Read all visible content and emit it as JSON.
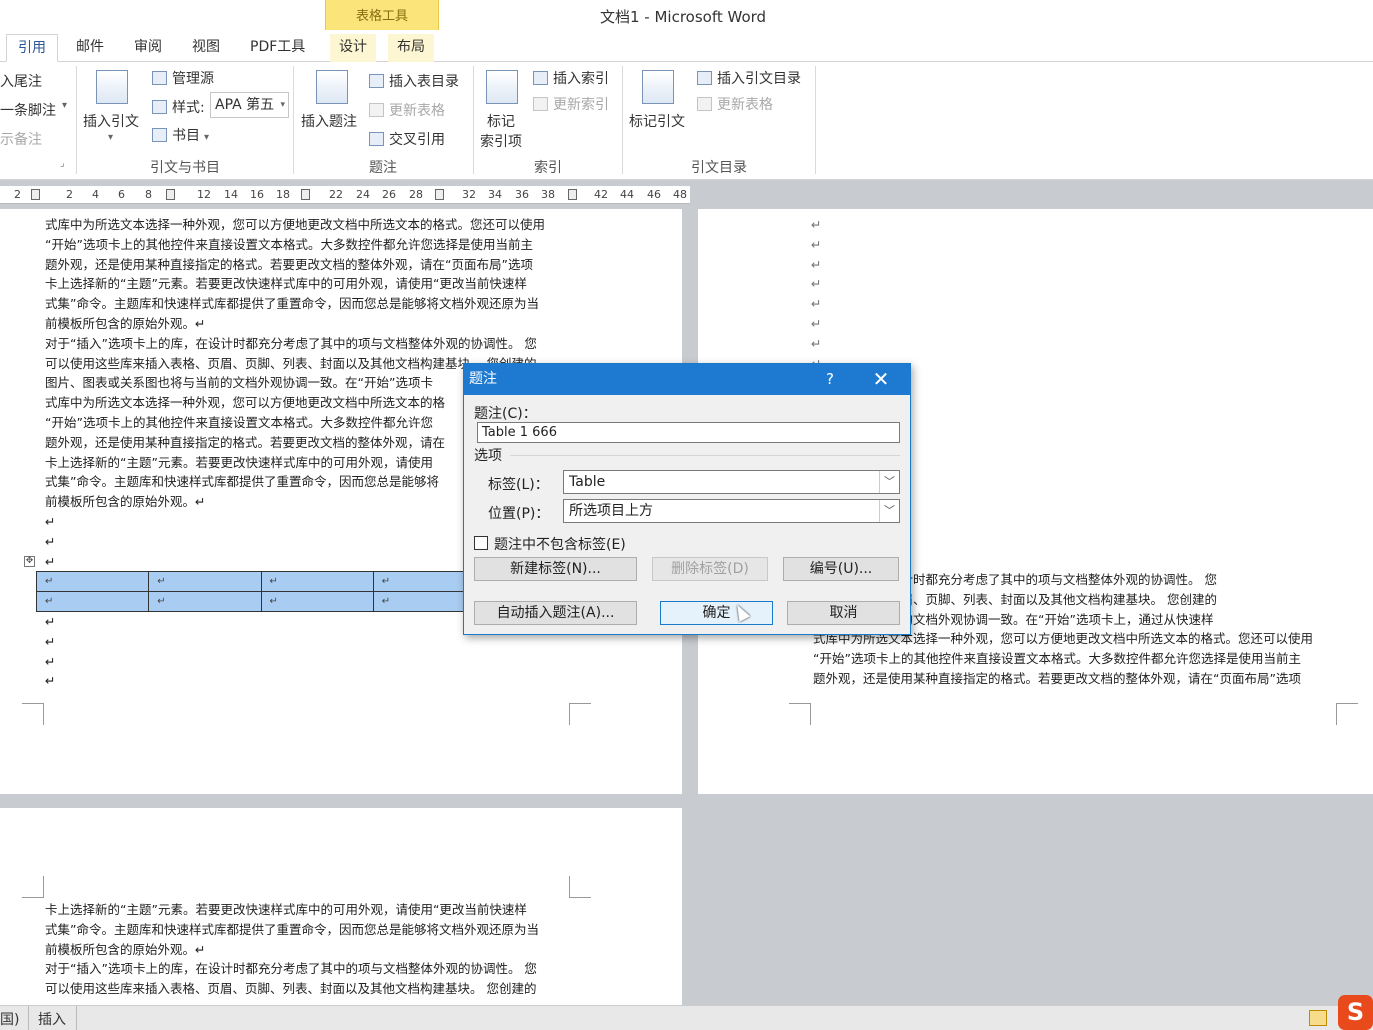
{
  "window": {
    "title": "文档1 - Microsoft Word",
    "context_tab_group": "表格工具"
  },
  "tabs": [
    "引用",
    "邮件",
    "审阅",
    "视图",
    "PDF工具",
    "设计",
    "布局"
  ],
  "ribbon": {
    "footnotes": {
      "insert_endnote": "入尾注",
      "next_footnote": "一条脚注",
      "show_notes": "示备注"
    },
    "citations": {
      "insert_citation": "插入引文",
      "manage_sources": "管理源",
      "style_label": "样式:",
      "style_value": "APA 第五",
      "bibliography": "书目",
      "group_label": "引文与书目"
    },
    "captions": {
      "insert_caption": "插入题注",
      "insert_table_of_figures": "插入表目录",
      "update_table": "更新表格",
      "cross_reference": "交叉引用",
      "group_label": "题注"
    },
    "index": {
      "mark_entry_line1": "标记",
      "mark_entry_line2": "索引项",
      "insert_index": "插入索引",
      "update_index": "更新索引",
      "group_label": "索引"
    },
    "toa": {
      "mark_citation": "标记引文",
      "insert_toa": "插入引文目录",
      "update_table": "更新表格",
      "group_label": "引文目录"
    }
  },
  "ruler_ticks": [
    "2",
    "2",
    "4",
    "6",
    "8",
    "12",
    "14",
    "16",
    "18",
    "22",
    "24",
    "26",
    "28",
    "32",
    "34",
    "36",
    "38",
    "42",
    "44",
    "46",
    "48"
  ],
  "doc": {
    "page1_lines": [
      "式库中为所选文本选择一种外观，您可以方便地更改文档中所选文本的格式。您还可以使用",
      "“开始”选项卡上的其他控件来直接设置文本格式。大多数控件都允许您选择是使用当前主",
      "题外观，还是使用某种直接指定的格式。若要更改文档的整体外观，请在“页面布局”选项",
      "卡上选择新的“主题”元素。若要更改快速样式库中的可用外观，请使用“更改当前快速样",
      "式集”命令。主题库和快速样式库都提供了重置命令，因而您总是能够将文档外观还原为当",
      "前模板所包含的原始外观。↵",
      "对于“插入”选项卡上的库，在设计时都充分考虑了其中的项与文档整体外观的协调性。 您",
      "可以使用这些库来插入表格、页眉、页脚、列表、封面以及其他文档构建基块。 您创建的",
      "图片、图表或关系图也将与当前的文档外观协调一致。在“开始”选项卡",
      "式库中为所选文本选择一种外观，您可以方便地更改文档中所选文本的格",
      "“开始”选项卡上的其他控件来直接设置文本格式。大多数控件都允许您",
      "题外观，还是使用某种直接指定的格式。若要更改文档的整体外观，请在",
      "卡上选择新的“主题”元素。若要更改快速样式库中的可用外观，请使用",
      "式集”命令。主题库和快速样式库都提供了重置命令，因而您总是能够将",
      "前模板所包含的原始外观。↵",
      "↵",
      "↵",
      "↵"
    ],
    "after_table_marks": [
      "↵",
      "↵",
      "↵",
      "↵"
    ],
    "table_cell_mark": "↵",
    "page2_marks": [
      "↵",
      "↵",
      "↵",
      "↵",
      "↵",
      "↵",
      "↵",
      "↵"
    ],
    "page2_lines": [
      "卡上的库，在设计时都充分考虑了其中的项与文档整体外观的协调性。 您",
      "来插入表格、页眉、页脚、列表、封面以及其他文档构建基块。 您创建的",
      "系图也将与当前的文档外观协调一致。在“开始”选项卡上，通过从快速样",
      "式库中为所选文本选择一种外观，您可以方便地更改文档中所选文本的格式。您还可以使用",
      "“开始”选项卡上的其他控件来直接设置文本格式。大多数控件都允许您选择是使用当前主",
      "题外观，还是使用某种直接指定的格式。若要更改文档的整体外观，请在“页面布局”选项"
    ],
    "page3_lines": [
      "卡上选择新的“主题”元素。若要更改快速样式库中的可用外观，请使用“更改当前快速样",
      "式集”命令。主题库和快速样式库都提供了重置命令，因而您总是能够将文档外观还原为当",
      "前模板所包含的原始外观。↵",
      "对于“插入”选项卡上的库，在设计时都充分考虑了其中的项与文档整体外观的协调性。 您",
      "可以使用这些库来插入表格、页眉、页脚、列表、封面以及其他文档构建基块。 您创建的"
    ]
  },
  "dialog": {
    "title": "题注",
    "help": "?",
    "close": "✕",
    "caption_label": "题注(C)：",
    "caption_value": "Table 1 666",
    "options_label": "选项",
    "label_label": "标签(L)：",
    "label_value": "Table",
    "position_label": "位置(P)：",
    "position_value": "所选项目上方",
    "exclude_label_checkbox": "题注中不包含标签(E)",
    "exclude_label_checked": false,
    "new_label_button": "新建标签(N)...",
    "delete_label_button": "删除标签(D)",
    "numbering_button": "编号(U)...",
    "autocaption_button": "自动插入题注(A)...",
    "ok_button": "确定",
    "cancel_button": "取消"
  },
  "status": {
    "language": "国)",
    "mode": "插入"
  },
  "tray": {
    "ime_logo": "S"
  }
}
